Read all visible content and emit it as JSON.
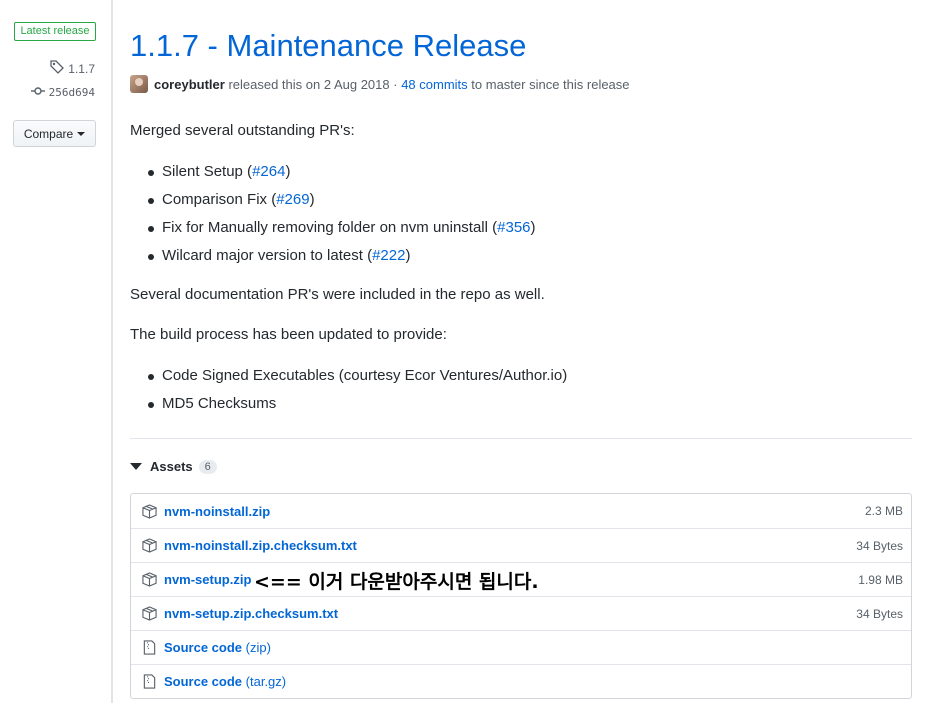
{
  "sidebar": {
    "badge": "Latest release",
    "tag": "1.1.7",
    "commit": "256d694",
    "compare_label": "Compare"
  },
  "release": {
    "title": "1.1.7 - Maintenance Release",
    "author": "coreybutler",
    "released_text": "released this on 2 Aug 2018 ·",
    "commits_link": "48 commits",
    "commits_suffix": "to master since this release"
  },
  "body": {
    "intro": "Merged several outstanding PR's:",
    "prs": [
      {
        "text": "Silent Setup (",
        "link": "#264",
        "close": ")"
      },
      {
        "text": "Comparison Fix (",
        "link": "#269",
        "close": ")"
      },
      {
        "text": "Fix for Manually removing folder on nvm uninstall (",
        "link": "#356",
        "close": ")"
      },
      {
        "text": "Wilcard major version to latest (",
        "link": "#222",
        "close": ")"
      }
    ],
    "docs_note": "Several documentation PR's were included in the repo as well.",
    "build_intro": "The build process has been updated to provide:",
    "build_items": [
      "Code Signed Executables (courtesy Ecor Ventures/Author.io)",
      "MD5 Checksums"
    ]
  },
  "assets": {
    "label": "Assets",
    "count": "6",
    "files": [
      {
        "name": "nvm-noinstall.zip",
        "size": "2.3 MB",
        "icon": "package-icon"
      },
      {
        "name": "nvm-noinstall.zip.checksum.txt",
        "size": "34 Bytes",
        "icon": "package-icon"
      },
      {
        "name": "nvm-setup.zip",
        "size": "1.98 MB",
        "icon": "package-icon"
      },
      {
        "name": "nvm-setup.zip.checksum.txt",
        "size": "34 Bytes",
        "icon": "package-icon"
      }
    ],
    "sources": [
      {
        "name": "Source code",
        "ext": "(zip)",
        "icon": "file-zip-icon"
      },
      {
        "name": "Source code",
        "ext": "(tar.gz)",
        "icon": "file-zip-icon"
      }
    ],
    "annotation": "<== 이거 다운받아주시면 됩니다."
  },
  "colors": {
    "link": "#0366d6",
    "badge_green": "#28a745",
    "text": "#24292e",
    "muted": "#586069"
  }
}
